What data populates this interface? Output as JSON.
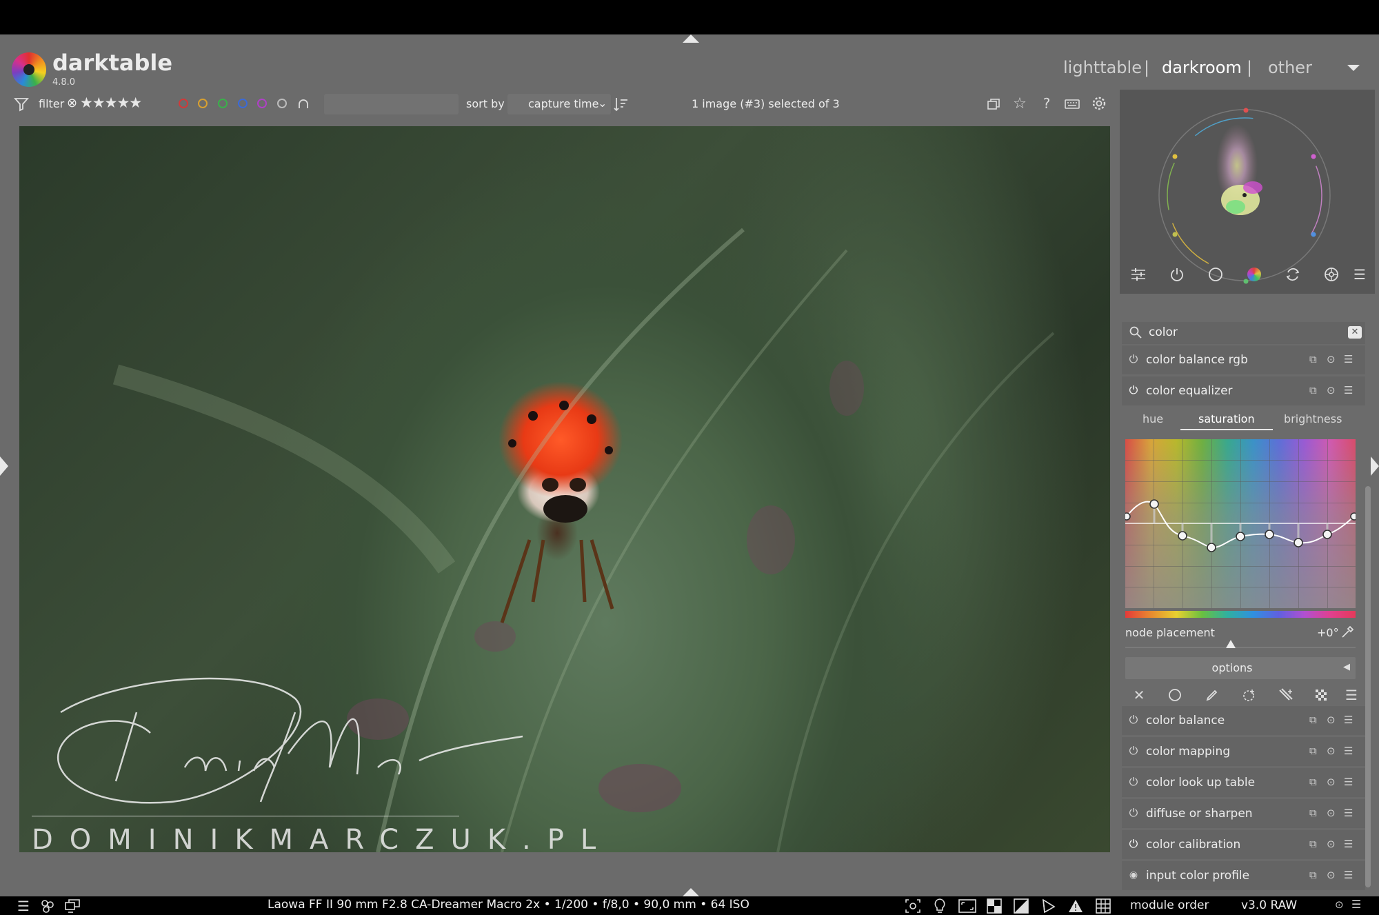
{
  "header": {
    "app_name": "darktable",
    "version": "4.8.0",
    "views": [
      "lighttable",
      "darkroom",
      "other"
    ],
    "separator": "|",
    "active_view": "darkroom"
  },
  "filterbar": {
    "filter_label": "filter",
    "stars": "★★★★★",
    "reject": "⊗",
    "sort_label": "sort by",
    "sort_value": "capture time",
    "selection_text": "1 image (#3) selected of 3",
    "color_labels": [
      "#d03a3a",
      "#d8a030",
      "#3ab04a",
      "#3a6ad8",
      "#b040c8",
      "#bdbdbd"
    ]
  },
  "image": {
    "signature_text": "Dominik Marczuk",
    "website": "DOMINIKMARCZUK.PL"
  },
  "bottombar": {
    "exif": "Laowa FF II 90 mm F2.8 CA-Dreamer Macro 2x • 1/200 • f/8,0 • 90,0 mm • 64 ISO"
  },
  "panel": {
    "search_value": "color",
    "modules_top": [
      {
        "label": "color balance rgb"
      },
      {
        "label": "color equalizer"
      }
    ],
    "tabs": [
      "hue",
      "saturation",
      "brightness"
    ],
    "active_tab": "saturation",
    "node_placement_label": "node placement",
    "node_placement_value": "+0°",
    "options_label": "options",
    "modules_bottom": [
      {
        "label": "color balance"
      },
      {
        "label": "color mapping"
      },
      {
        "label": "color look up table"
      },
      {
        "label": "diffuse or sharpen"
      },
      {
        "label": "color calibration"
      },
      {
        "label": "input color profile"
      }
    ],
    "module_order_label": "module order",
    "module_order_value": "v3.0 RAW"
  }
}
